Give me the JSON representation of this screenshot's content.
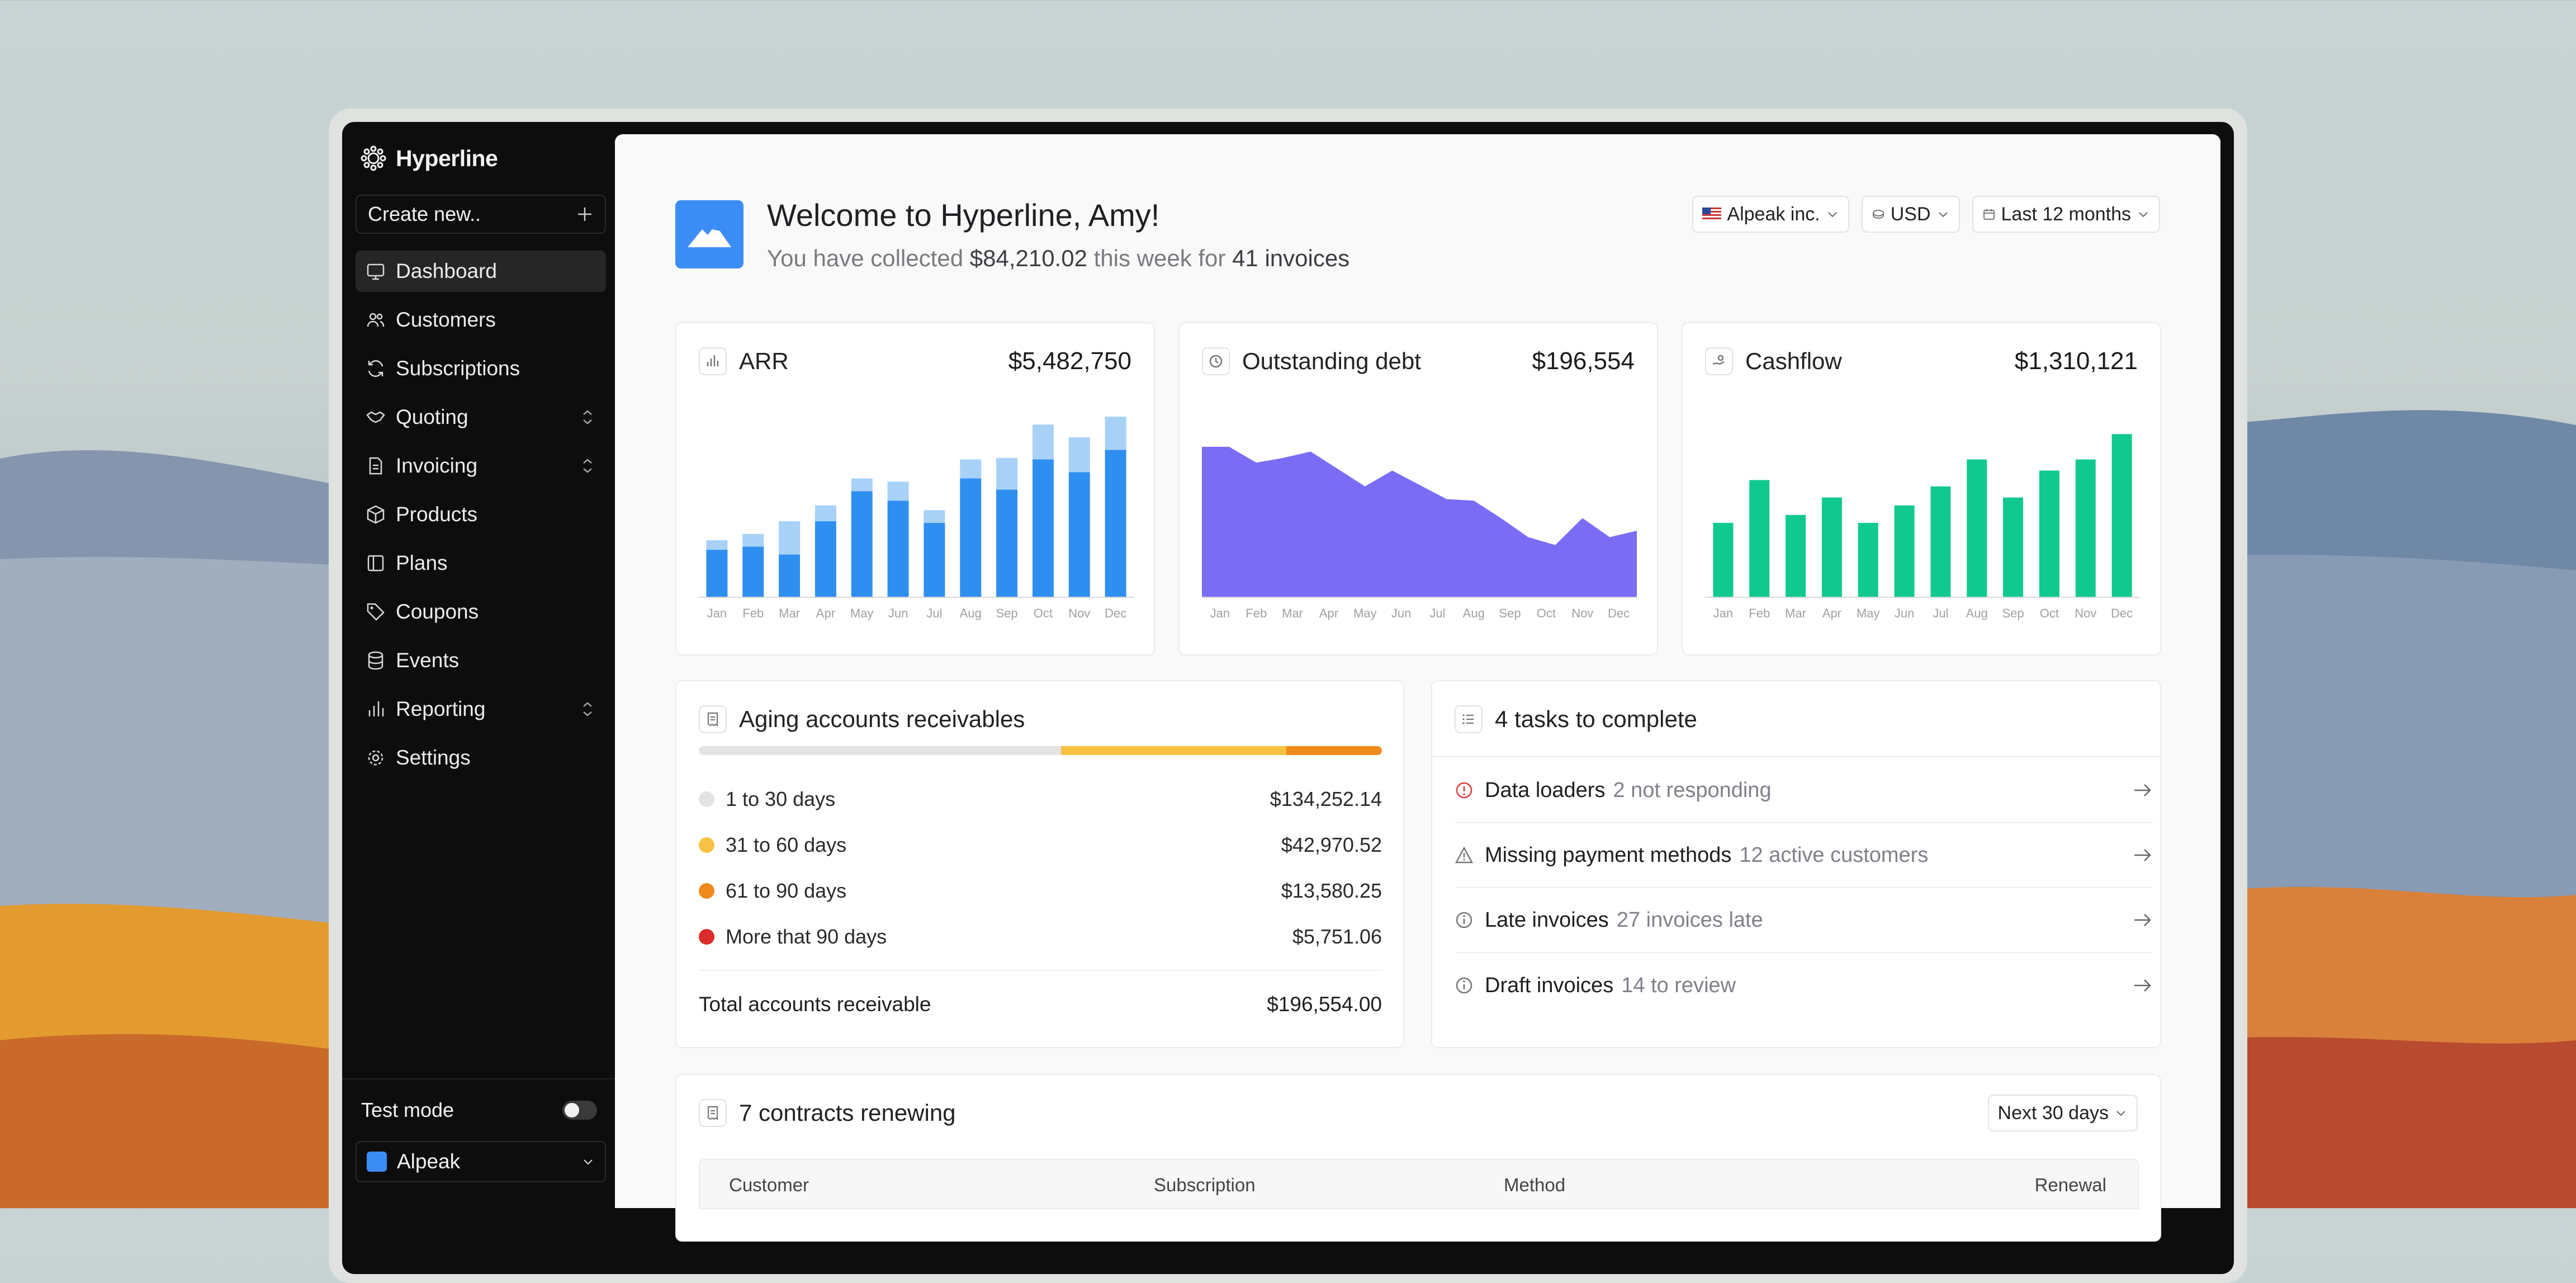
{
  "app": {
    "name": "Hyperline",
    "create_label": "Create new..",
    "nav": [
      {
        "label": "Dashboard",
        "icon": "dashboard-icon",
        "active": true,
        "expandable": false
      },
      {
        "label": "Customers",
        "icon": "users-icon",
        "active": false,
        "expandable": false
      },
      {
        "label": "Subscriptions",
        "icon": "refresh-icon",
        "active": false,
        "expandable": false
      },
      {
        "label": "Quoting",
        "icon": "handshake-icon",
        "active": false,
        "expandable": true
      },
      {
        "label": "Invoicing",
        "icon": "file-icon",
        "active": false,
        "expandable": true
      },
      {
        "label": "Products",
        "icon": "box-icon",
        "active": false,
        "expandable": false
      },
      {
        "label": "Plans",
        "icon": "columns-icon",
        "active": false,
        "expandable": false
      },
      {
        "label": "Coupons",
        "icon": "tag-icon",
        "active": false,
        "expandable": false
      },
      {
        "label": "Events",
        "icon": "database-icon",
        "active": false,
        "expandable": false
      },
      {
        "label": "Reporting",
        "icon": "bar-chart-icon",
        "active": false,
        "expandable": true
      },
      {
        "label": "Settings",
        "icon": "gear-icon",
        "active": false,
        "expandable": false
      }
    ],
    "test_mode_label": "Test mode",
    "test_mode_on": false,
    "workspace": "Alpeak"
  },
  "header": {
    "welcome": "Welcome to Hyperline, Amy!",
    "collected_prefix": "You have collected ",
    "collected_amount": "$84,210.02",
    "collected_mid": " this week for ",
    "collected_invoices": "41 invoices",
    "filters": {
      "company": "Alpeak inc.",
      "currency": "USD",
      "period": "Last 12 months"
    }
  },
  "metrics": {
    "arr": {
      "title": "ARR",
      "value": "$5,482,750"
    },
    "debt": {
      "title": "Outstanding debt",
      "value": "$196,554"
    },
    "cashflow": {
      "title": "Cashflow",
      "value": "$1,310,121"
    }
  },
  "chart_data": [
    {
      "type": "bar",
      "title": "ARR",
      "categories": [
        "Jan",
        "Feb",
        "Mar",
        "Apr",
        "May",
        "Jun",
        "Jul",
        "Aug",
        "Sep",
        "Oct",
        "Nov",
        "Dec"
      ],
      "series": [
        {
          "values": [
            30,
            32,
            27,
            48,
            67,
            61,
            47,
            75,
            68,
            87,
            79,
            93
          ]
        },
        {
          "values": [
            6,
            8,
            21,
            10,
            8,
            12,
            8,
            12,
            20,
            22,
            22,
            21
          ]
        }
      ],
      "ylim": [
        0,
        120
      ],
      "colors": [
        "#2f8ff0",
        "#a8d1f8"
      ]
    },
    {
      "type": "area",
      "title": "Outstanding debt",
      "categories": [
        "Jan",
        "Feb",
        "Mar",
        "Apr",
        "May",
        "Jun",
        "Jul",
        "Aug",
        "Sep",
        "Oct",
        "Nov",
        "Dec"
      ],
      "values": [
        95,
        95,
        85,
        88,
        92,
        81,
        70,
        80,
        71,
        62,
        61,
        50,
        38,
        33,
        50,
        38,
        42
      ],
      "ylim": [
        0,
        120
      ],
      "colors": [
        "#7b6cf6"
      ]
    },
    {
      "type": "bar",
      "title": "Cashflow",
      "categories": [
        "Jan",
        "Feb",
        "Mar",
        "Apr",
        "May",
        "Jun",
        "Jul",
        "Aug",
        "Sep",
        "Oct",
        "Nov",
        "Dec"
      ],
      "values": [
        47,
        74,
        52,
        63,
        47,
        58,
        70,
        87,
        63,
        80,
        87,
        103
      ],
      "ylim": [
        0,
        120
      ],
      "colors": [
        "#10c98f"
      ]
    }
  ],
  "aging": {
    "title": "Aging accounts receivables",
    "segments": [
      {
        "label": "1 to 30 days",
        "amount": "$134,252.14",
        "share": 0.53,
        "color": "#e3e3e3"
      },
      {
        "label": "31 to 60 days",
        "amount": "$42,970.52",
        "share": 0.33,
        "color": "#f7c243"
      },
      {
        "label": "61 to 90 days",
        "amount": "$13,580.25",
        "share": 0.14,
        "color": "#f08a1c"
      },
      {
        "label": "More that 90 days",
        "amount": "$5,751.06",
        "share": 0.0,
        "color": "#dc2b2b"
      }
    ],
    "total_label": "Total accounts receivable",
    "total_amount": "$196,554.00"
  },
  "tasks": {
    "title": "4 tasks to complete",
    "items": [
      {
        "title": "Data loaders",
        "sub": "2 not responding",
        "icon": "alert-circle-icon",
        "color": "#e03a3a"
      },
      {
        "title": "Missing payment methods",
        "sub": "12 active customers",
        "icon": "warning-triangle-icon",
        "color": "#777"
      },
      {
        "title": "Late invoices",
        "sub": "27 invoices late",
        "icon": "info-circle-icon",
        "color": "#777"
      },
      {
        "title": "Draft invoices",
        "sub": "14 to review",
        "icon": "info-circle-icon",
        "color": "#777"
      }
    ]
  },
  "contracts": {
    "title": "7 contracts renewing",
    "period": "Next 30 days",
    "columns": [
      "Customer",
      "Subscription",
      "Method",
      "Renewal"
    ]
  }
}
